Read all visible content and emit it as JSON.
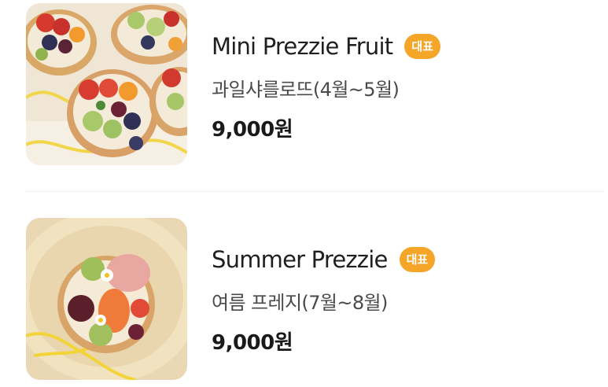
{
  "menu": {
    "items": [
      {
        "name": "Mini Prezzie Fruit",
        "badge": "대표",
        "description": "과일샤를로뜨(4월~5월)",
        "price": "9,000원",
        "image_alt": "mini-fruit-tarts-photo"
      },
      {
        "name": "Summer Prezzie",
        "badge": "대표",
        "description": "여름 프레지(7월~8월)",
        "price": "9,000원",
        "image_alt": "summer-fruit-tart-photo"
      }
    ]
  },
  "colors": {
    "badge_bg": "#f5a528",
    "badge_text": "#ffffff",
    "title_text": "#1f1f1f",
    "desc_text": "#4a4a4a",
    "divider": "#ececec"
  }
}
